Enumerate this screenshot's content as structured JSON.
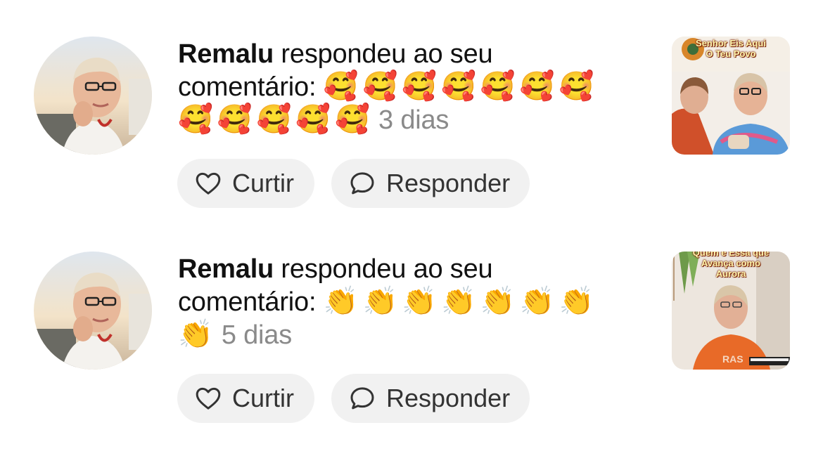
{
  "notifications": [
    {
      "username": "Remalu",
      "action_text": " respondeu ao seu comentário: ",
      "emojis": "🥰🥰🥰🥰🥰🥰🥰🥰🥰🥰🥰🥰",
      "time_ago": "3 dias",
      "like_label": "Curtir",
      "reply_label": "Responder",
      "thumbnail_caption_1": "Senhor Eis Aqui",
      "thumbnail_caption_2": "O Teu Povo"
    },
    {
      "username": "Remalu",
      "action_text": " respondeu ao seu comentário: ",
      "emojis": "👏👏👏👏👏👏👏👏",
      "time_ago": "5 dias",
      "like_label": "Curtir",
      "reply_label": "Responder",
      "thumbnail_caption_1": "Quem é Essa que",
      "thumbnail_caption_2": "Avança como",
      "thumbnail_caption_3": "Aurora"
    }
  ],
  "colors": {
    "pill_bg": "#f1f1f1",
    "time_gray": "#8a8a8a",
    "text": "#111111"
  },
  "icons": {
    "like": "heart-outline-icon",
    "reply": "speech-bubble-icon"
  }
}
